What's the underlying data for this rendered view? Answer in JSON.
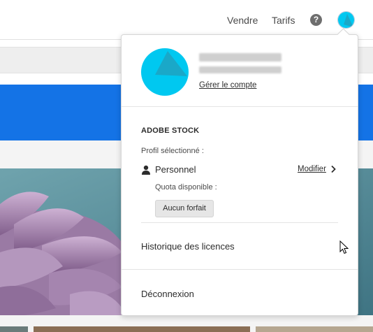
{
  "header": {
    "nav": {
      "sell": "Vendre",
      "pricing": "Tarifs"
    },
    "help_symbol": "?",
    "icons": {
      "help": "help-circle-icon",
      "avatar": "user-avatar-icon"
    }
  },
  "account_menu": {
    "manage_account": "Gérer le compte",
    "section_title": "ADOBE STOCK",
    "selected_profile_label": "Profil sélectionné :",
    "profile_name": "Personnel",
    "modify": "Modifier",
    "quota_label": "Quota disponible :",
    "plan_button": "Aucun forfait",
    "license_history": "Historique des licences",
    "sign_out": "Déconnexion"
  },
  "colors": {
    "brand_blue": "#1473e6",
    "avatar_cyan": "#00c8f0",
    "avatar_teal": "#1aa8c8",
    "text": "#2c2c2c"
  }
}
